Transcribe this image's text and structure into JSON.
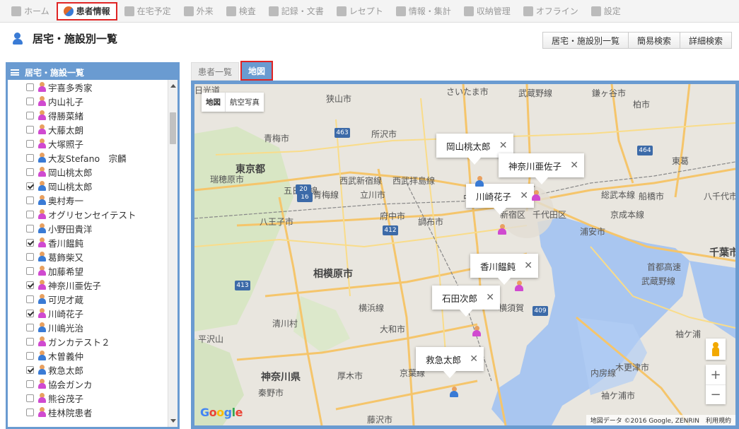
{
  "nav": [
    {
      "label": "ホーム",
      "icon": "home-icon",
      "active": false
    },
    {
      "label": "患者情報",
      "icon": "patient-info-icon",
      "active": true
    },
    {
      "label": "在宅予定",
      "icon": "clock-icon",
      "active": false
    },
    {
      "label": "外来",
      "icon": "person-icon",
      "active": false
    },
    {
      "label": "検査",
      "icon": "chart-icon",
      "active": false
    },
    {
      "label": "記録・文書",
      "icon": "document-icon",
      "active": false
    },
    {
      "label": "レセプト",
      "icon": "receipt-icon",
      "active": false
    },
    {
      "label": "情報・集計",
      "icon": "stats-icon",
      "active": false
    },
    {
      "label": "収納管理",
      "icon": "wallet-icon",
      "active": false
    },
    {
      "label": "オフライン",
      "icon": "offline-icon",
      "active": false
    },
    {
      "label": "設定",
      "icon": "gear-icon",
      "active": false
    }
  ],
  "page_title": "居宅・施設別一覧",
  "search_buttons": [
    "居宅・施設別一覧",
    "簡易検索",
    "詳細検索"
  ],
  "sidebar": {
    "header": "居宅・施設一覧",
    "items": [
      {
        "name": "宇喜多秀家",
        "checked": false,
        "sex": "f"
      },
      {
        "name": "内山礼子",
        "checked": false,
        "sex": "f"
      },
      {
        "name": "得勝菜緒",
        "checked": false,
        "sex": "f"
      },
      {
        "name": "大藤太朗",
        "checked": false,
        "sex": "f"
      },
      {
        "name": "大塚照子",
        "checked": false,
        "sex": "f"
      },
      {
        "name": "大友Stefano　宗麟",
        "checked": false,
        "sex": "m"
      },
      {
        "name": "岡山桃太郎",
        "checked": false,
        "sex": "f"
      },
      {
        "name": "岡山桃太郎",
        "checked": true,
        "sex": "m"
      },
      {
        "name": "奥村寿一",
        "checked": false,
        "sex": "m"
      },
      {
        "name": "オグリセンセイテスト",
        "checked": false,
        "sex": "f"
      },
      {
        "name": "小野田貴洋",
        "checked": false,
        "sex": "m"
      },
      {
        "name": "香川饂飩",
        "checked": true,
        "sex": "f"
      },
      {
        "name": "葛飾柴又",
        "checked": false,
        "sex": "m"
      },
      {
        "name": "加藤希望",
        "checked": false,
        "sex": "f"
      },
      {
        "name": "神奈川亜佐子",
        "checked": true,
        "sex": "f"
      },
      {
        "name": "可児才蔵",
        "checked": false,
        "sex": "m"
      },
      {
        "name": "川崎花子",
        "checked": true,
        "sex": "f"
      },
      {
        "name": "川嶋光治",
        "checked": false,
        "sex": "m"
      },
      {
        "name": "ガンカテスト２",
        "checked": false,
        "sex": "f"
      },
      {
        "name": "木曽義仲",
        "checked": false,
        "sex": "m"
      },
      {
        "name": "救急太郎",
        "checked": true,
        "sex": "m"
      },
      {
        "name": "協会ガンカ",
        "checked": false,
        "sex": "f"
      },
      {
        "name": "熊谷茂子",
        "checked": false,
        "sex": "f"
      },
      {
        "name": "桂林院患者",
        "checked": false,
        "sex": "f"
      }
    ]
  },
  "tabs": [
    {
      "label": "患者一覧",
      "active": false
    },
    {
      "label": "地図",
      "active": true
    }
  ],
  "map": {
    "type_buttons": [
      "地図",
      "航空写真"
    ],
    "info_windows": [
      "岡山桃太郎",
      "神奈川亜佐子",
      "川崎花子",
      "香川饂飩",
      "石田次郎",
      "救急太郎"
    ],
    "place_labels": [
      "狭山市",
      "所沢市",
      "さいたま市",
      "武蔵野線",
      "鎌ヶ谷市",
      "柏市",
      "青梅市",
      "東京都",
      "五日市線",
      "西武新宿線",
      "西武拝島線",
      "青梅線",
      "立川市",
      "中央本",
      "東京",
      "総武本線",
      "船橋市",
      "八千代市",
      "瑞穂原市",
      "八王子市",
      "府中市",
      "調布市",
      "新宿区",
      "千代田区",
      "浦安市",
      "京成本線",
      "千葉市",
      "相模原市",
      "横浜線",
      "大和市",
      "神奈川県",
      "厚木市",
      "秦野市",
      "藤沢市",
      "清川村",
      "平沢山",
      "木更津市",
      "袖ケ浦市",
      "袖ケ浦",
      "内房線",
      "横須賀",
      "首都高速",
      "東葛",
      "武蔵野線",
      "京葉線",
      "日光道"
    ],
    "shields": [
      "463",
      "16",
      "412",
      "20",
      "413",
      "409",
      "464"
    ],
    "attribution": "地図データ ©2016 Google, ZENRIN　利用規約",
    "google": "Google",
    "zoom_in": "+",
    "zoom_out": "−"
  }
}
